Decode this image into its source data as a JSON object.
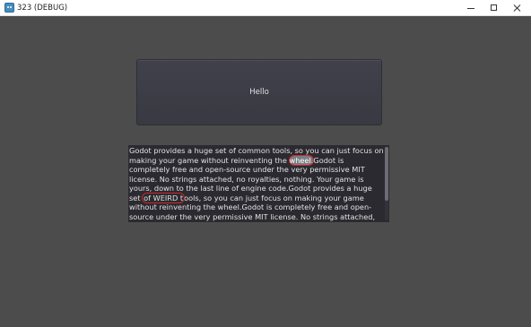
{
  "window": {
    "title": "323 (DEBUG)",
    "icon": "godot-icon",
    "controls": {
      "minimize": "minimize-icon",
      "maximize": "maximize-icon",
      "close": "close-icon"
    }
  },
  "scene": {
    "button_label": "Hello",
    "text_panel": {
      "segment_1": "Godot provides a huge set of common tools, so you can just focus on making your game without reinventing the ",
      "highlight_wheel": "wheel.",
      "segment_2": "Godot is completely free and open-source under the very permissive MIT license. No strings attached, no royalties, nothing. Your game is yours, down to the last line of engine code.Godot provides a huge set ",
      "highlight_weird": "of WEIRD t",
      "segment_3": "ools, so you can just focus on making your game without reinventing the wheel.Godot is completely free and open-source under the very permissive MIT license. No strings attached, no royalties, nothing. Your game is yours, down to the last line of engine code.",
      "scroll_position": 0.0,
      "highlight_color": "#cc2a2a"
    }
  }
}
